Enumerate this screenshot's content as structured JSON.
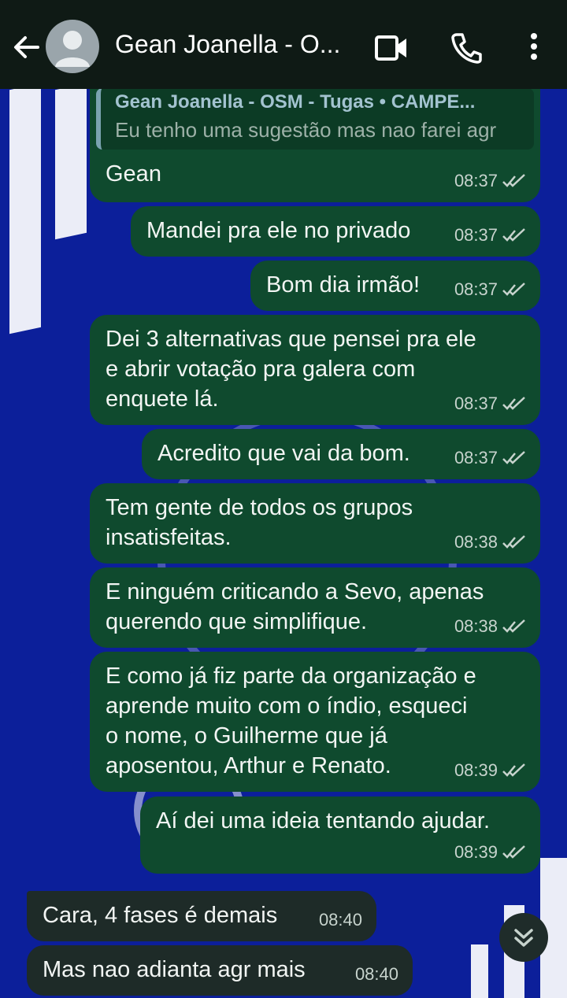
{
  "header": {
    "title": "Gean Joanella - O...",
    "back_icon": "arrow-left-icon",
    "video_icon": "video-call-icon",
    "call_icon": "phone-icon",
    "menu_icon": "more-vert-icon"
  },
  "quoted": {
    "name": "Gean Joanella - OSM - Tugas • CAMPE...",
    "text": "Eu tenho uma sugestão mas nao farei agr"
  },
  "messages": [
    {
      "text": "Gean",
      "time": "08:37",
      "dir": "out"
    },
    {
      "text": "Mandei pra ele no privado",
      "time": "08:37",
      "dir": "out"
    },
    {
      "text": "Bom dia irmão!",
      "time": "08:37",
      "dir": "out"
    },
    {
      "text": "Dei 3 alternativas que pensei pra ele\ne abrir votação pra galera com\nenquete lá.",
      "time": "08:37",
      "dir": "out"
    },
    {
      "text": "Acredito que vai da bom.",
      "time": "08:37",
      "dir": "out"
    },
    {
      "text": "Tem gente de todos os grupos\ninsatisfeitas.",
      "time": "08:38",
      "dir": "out"
    },
    {
      "text": "E ninguém criticando a Sevo, apenas\nquerendo  que simplifique.",
      "time": "08:38",
      "dir": "out"
    },
    {
      "text": "E como já fiz parte da organização e\naprende muito com o índio, esqueci\no nome, o Guilherme que já\naposentou, Arthur e Renato.",
      "time": "08:39",
      "dir": "out"
    },
    {
      "text": "Aí dei uma ideia tentando ajudar.",
      "time": "08:39",
      "dir": "out"
    },
    {
      "text": "Cara, 4 fases é demais",
      "time": "08:40",
      "dir": "in"
    },
    {
      "text": "Mas nao adianta agr mais",
      "time": "08:40",
      "dir": "in"
    }
  ],
  "colors": {
    "outgoing_bubble": "#0f4a2e",
    "incoming_bubble": "#1e2b28",
    "header_bg": "#0f1a15",
    "wallpaper": "#0c1f9a"
  }
}
